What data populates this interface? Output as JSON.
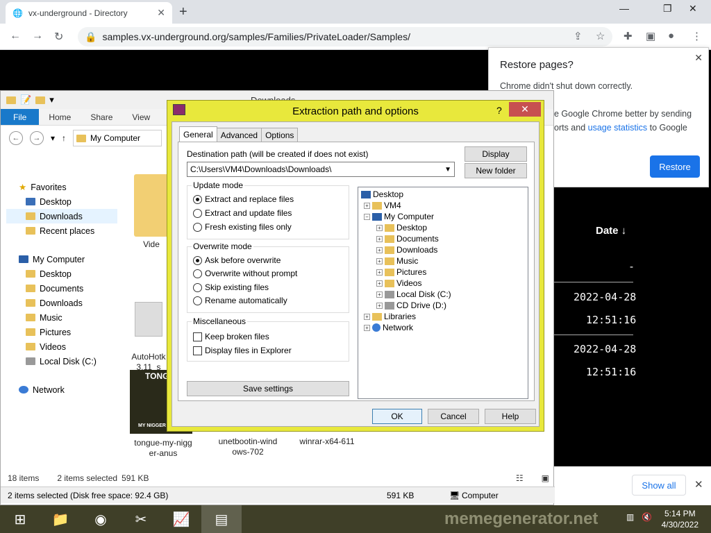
{
  "browser": {
    "tab_title": "vx-underground - Directory",
    "tab_close": "✕",
    "new_tab": "+",
    "url": "samples.vx-underground.org/samples/Families/PrivateLoader/Samples/"
  },
  "restore_popup": {
    "title": "Restore pages?",
    "message": "Chrome didn't shut down correctly.",
    "partial_text_1": "e Google Chrome better by sending",
    "partial_text_2": "orts and",
    "link": "usage statistics",
    "partial_text_3": "to Google",
    "button": "Restore"
  },
  "webpage": {
    "date_header": "Date ↓",
    "dash": "-",
    "rows": [
      {
        "date": "2022-04-28",
        "time": "12:51:16"
      },
      {
        "date": "2022-04-28",
        "time": "12:51:16"
      }
    ]
  },
  "download_bar": {
    "show_all": "Show all"
  },
  "explorer": {
    "title": "Downloads",
    "ribbon_tabs": [
      "File",
      "Home",
      "Share",
      "View"
    ],
    "address": "My Computer",
    "nav": {
      "favorites": "Favorites",
      "fav_items": [
        "Desktop",
        "Downloads",
        "Recent places"
      ],
      "computer": "My Computer",
      "comp_items": [
        "Desktop",
        "Documents",
        "Downloads",
        "Music",
        "Pictures",
        "Videos",
        "Local Disk (C:)"
      ],
      "network": "Network"
    },
    "files": {
      "videos_partial": "Vide",
      "autohotkey": "AutoHotk",
      "autohotkey2": "3.11_s",
      "tongue1": "tongue-my-nigg",
      "tongue2": "er-anus",
      "unet1": "unetbootin-wind",
      "unet2": "ows-702",
      "winrar": "winrar-x64-611",
      "thumb_caption_top": "TONG",
      "thumb_caption_bottom": "MY NIGGER ANUS"
    },
    "status": {
      "items": "18 items",
      "selected": "2 items selected",
      "size": "591 KB",
      "bottom_selected": "2 items selected (Disk free space: 92.4 GB)",
      "bottom_size": "591 KB",
      "bottom_location": "Computer"
    }
  },
  "dialog": {
    "title": "Extraction path and options",
    "help": "?",
    "tabs": [
      "General",
      "Advanced",
      "Options"
    ],
    "dest_label": "Destination path (will be created if does not exist)",
    "dest_value": "C:\\Users\\VM4\\Downloads\\Downloads\\",
    "display_btn": "Display",
    "new_folder_btn": "New folder",
    "update_mode": {
      "title": "Update mode",
      "options": [
        "Extract and replace files",
        "Extract and update files",
        "Fresh existing files only"
      ],
      "selected": 0
    },
    "overwrite_mode": {
      "title": "Overwrite mode",
      "options": [
        "Ask before overwrite",
        "Overwrite without prompt",
        "Skip existing files",
        "Rename automatically"
      ],
      "selected": 0
    },
    "misc": {
      "title": "Miscellaneous",
      "options": [
        "Keep broken files",
        "Display files in Explorer"
      ]
    },
    "save_settings": "Save settings",
    "tree": {
      "desktop": "Desktop",
      "vm4": "VM4",
      "my_computer": "My Computer",
      "children": [
        "Desktop",
        "Documents",
        "Downloads",
        "Music",
        "Pictures",
        "Videos",
        "Local Disk (C:)",
        "CD Drive (D:)"
      ],
      "libraries": "Libraries",
      "network": "Network"
    },
    "ok": "OK",
    "cancel": "Cancel",
    "help_btn": "Help"
  },
  "taskbar": {
    "time": "5:14 PM",
    "date": "4/30/2022",
    "watermark": "memegenerator.net"
  },
  "colors": {
    "dialog_frame": "#e8e83c",
    "accent_blue": "#1a73e8",
    "file_tab": "#1979ca"
  }
}
